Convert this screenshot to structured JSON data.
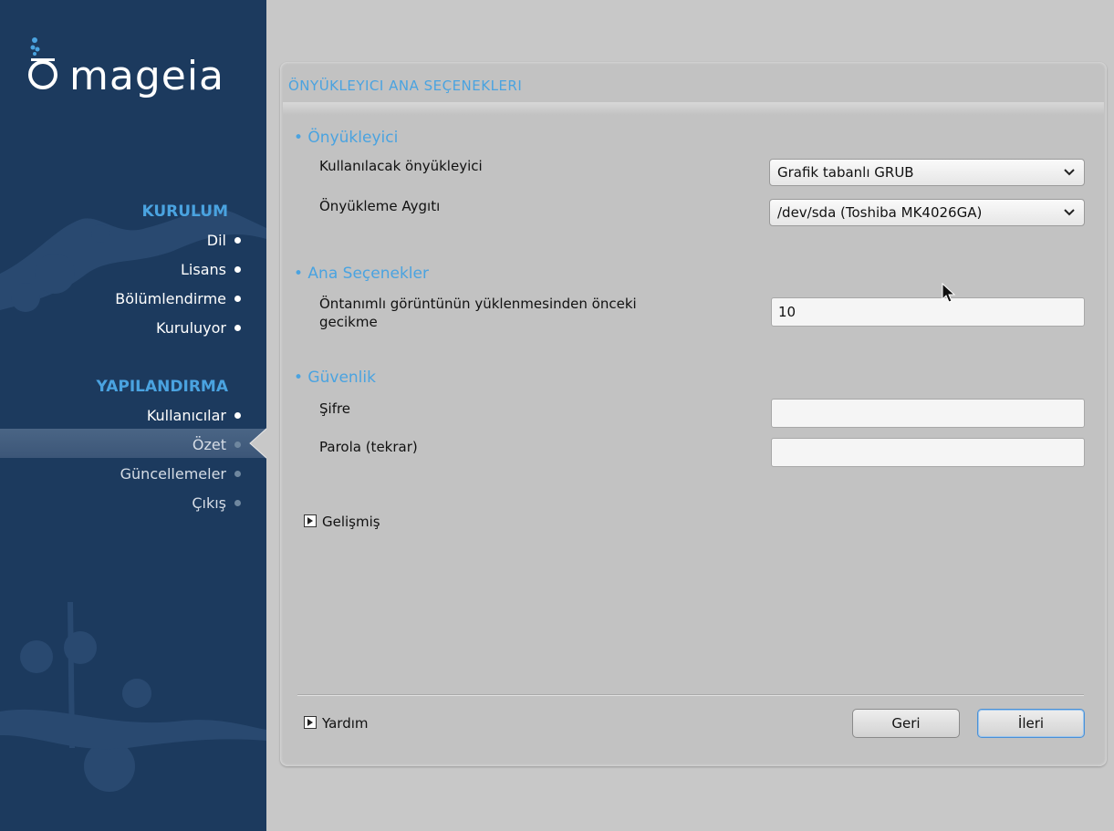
{
  "sidebar": {
    "logo_text": "mageia",
    "sections": [
      {
        "title": "KURULUM",
        "items": [
          {
            "label": "Dil"
          },
          {
            "label": "Lisans"
          },
          {
            "label": "Bölümlendirme"
          },
          {
            "label": "Kuruluyor"
          }
        ]
      },
      {
        "title": "YAPILANDIRMA",
        "items": [
          {
            "label": "Kullanıcılar"
          },
          {
            "label": "Özet",
            "active": true
          },
          {
            "label": "Güncellemeler"
          },
          {
            "label": "Çıkış"
          }
        ]
      }
    ]
  },
  "panel": {
    "title": "ÖNYÜKLEYICI ANA SEÇENEKLERI",
    "groups": {
      "bootloader": {
        "title": "• Önyükleyici",
        "use_label": "Kullanılacak önyükleyici",
        "use_value": "Grafik tabanlı GRUB",
        "device_label": "Önyükleme Aygıtı",
        "device_value": "/dev/sda (Toshiba MK4026GA)"
      },
      "main": {
        "title": "• Ana Seçenekler",
        "delay_label_line1": "Öntanımlı görüntünün yüklenmesinden önceki",
        "delay_label_line2": "gecikme",
        "delay_value": "10"
      },
      "security": {
        "title": "• Güvenlik",
        "password_label": "Şifre",
        "password_value": "",
        "password_repeat_label": "Parola (tekrar)",
        "password_repeat_value": ""
      }
    },
    "advanced_label": "Gelişmiş",
    "help_label": "Yardım",
    "back_label": "Geri",
    "next_label": "İleri"
  },
  "colors": {
    "sidebar_bg": "#1c3a5e",
    "accent": "#4aa3e0",
    "panel_bg": "#c2c2c2"
  }
}
